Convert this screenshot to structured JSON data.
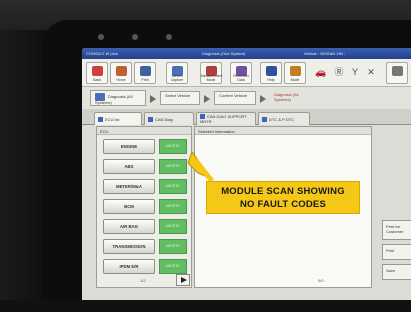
{
  "titlebar": {
    "app": "CONSULT-III plus",
    "center": "Diagnosis (One System)",
    "right": "Vehicle : NISSAN  VIN :"
  },
  "toolbar": {
    "buttons": [
      {
        "label": "Back",
        "icon": "back-icon",
        "color": "#d04040"
      },
      {
        "label": "Home",
        "icon": "home-icon",
        "color": "#c06030"
      },
      {
        "label": "Print",
        "icon": "print-icon",
        "color": "#4060a0"
      },
      {
        "label": "Screen Capture",
        "icon": "camera-icon",
        "color": "#4a6fb8"
      },
      {
        "label": "Measurement Mode",
        "icon": "measure-icon",
        "color": "#b04040"
      },
      {
        "label": "Recorded Data",
        "icon": "data-icon",
        "color": "#7050a0"
      },
      {
        "label": "Help",
        "icon": "help-icon",
        "color": "#3050a0"
      },
      {
        "label": "Mode",
        "icon": "mode-icon",
        "color": "#c08020"
      }
    ],
    "status": [
      "🚗",
      "Ⓡ",
      "Y",
      "✕"
    ]
  },
  "crumbs": {
    "c1": "Diagnosis (All Systems)",
    "c2": "Select Vehicle",
    "c3": "Confirm Vehicle",
    "c4": "Diagnosis (All Systems)"
  },
  "tabs": [
    {
      "label": "ECU list",
      "active": true
    },
    {
      "label": "CAN Diag",
      "active": false
    },
    {
      "label": "CAN DIAG SUPPORT MNTR",
      "active": false
    },
    {
      "label": "DTC & P DTC",
      "active": false
    }
  ],
  "left_panel": {
    "header": "ECU"
  },
  "right_panel": {
    "header": "Selected Information"
  },
  "modules": [
    {
      "name": "ENGINE",
      "status": "NO DTC"
    },
    {
      "name": "ABS",
      "status": "NO DTC"
    },
    {
      "name": "METER/M&A",
      "status": "NO DTC"
    },
    {
      "name": "BCM",
      "status": "NO DTC"
    },
    {
      "name": "AIR BAG",
      "status": "NO DTC"
    },
    {
      "name": "TRANSMISSION",
      "status": "NO DTC"
    },
    {
      "name": "IPDM E/R",
      "status": "NO DTC"
    }
  ],
  "pager": {
    "left": "1/2",
    "right": "0/0"
  },
  "side_buttons": [
    "Print for Customer",
    "Print",
    "Save"
  ],
  "callout": {
    "line1": "MODULE SCAN SHOWING",
    "line2": "NO FAULT CODES",
    "color": "#f5c818"
  }
}
